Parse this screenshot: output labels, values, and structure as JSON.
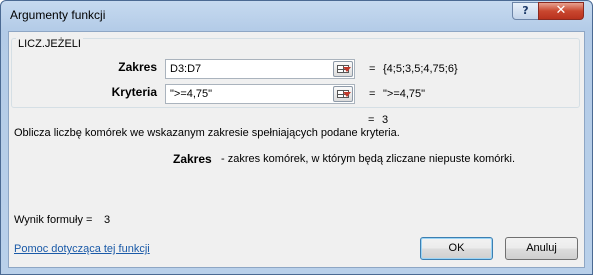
{
  "window": {
    "title": "Argumenty funkcji",
    "help_label": "?",
    "close_label": "✕"
  },
  "function": {
    "name": "LICZ.JEŻELI",
    "args": [
      {
        "label": "Zakres",
        "value": "D3:D7",
        "evaluated": "{4;5;3,5;4,75;6}"
      },
      {
        "label": "Kryteria",
        "value": "\">=4,75\"",
        "evaluated": "\">=4,75\""
      }
    ],
    "eq_sign": "=",
    "result_value": "3",
    "description": "Oblicza liczbę komórek we wskazanym zakresie spełniających podane kryteria.",
    "param_name": "Zakres",
    "param_description": "- zakres komórek, w którym będą zliczane niepuste komórki."
  },
  "footer": {
    "formula_result_label": "Wynik formuły =",
    "formula_result_value": "3",
    "help_link": "Pomoc dotycząca tej funkcji",
    "ok_label": "OK",
    "cancel_label": "Anuluj"
  },
  "colors": {
    "title_gradient": "#c6daf0",
    "link": "#1a5aa8",
    "close_button": "#c9472f"
  },
  "icons": [
    "help-icon",
    "close-icon",
    "collapse-dialog-icon"
  ]
}
